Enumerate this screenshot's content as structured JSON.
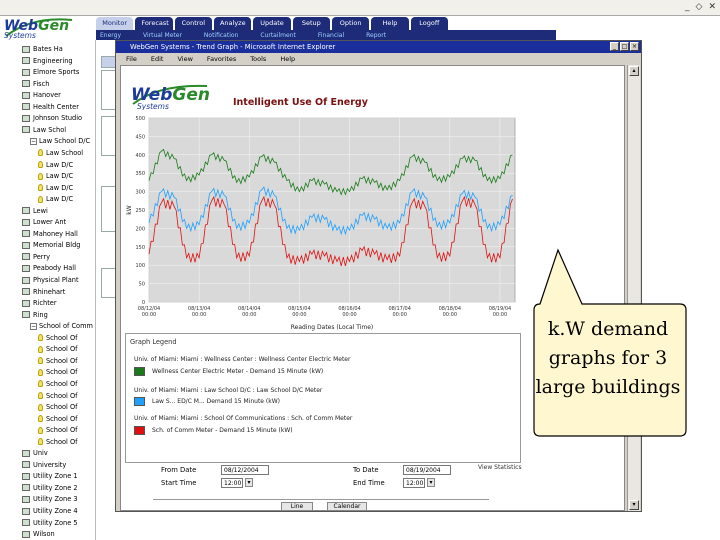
{
  "window": {
    "title": "WebGen Systems - Trend Graph - Microsoft Internet Explorer"
  },
  "brand": {
    "name_web": "Web",
    "name_gen": "Gen",
    "tagline": "Systems",
    "color_blue": "#1d3c9a",
    "color_green": "#2a8a2a"
  },
  "tabs": [
    {
      "label": "Monitor",
      "active": true
    },
    {
      "label": "Forecast"
    },
    {
      "label": "Control"
    },
    {
      "label": "Analyze"
    },
    {
      "label": "Update"
    },
    {
      "label": "Setup"
    },
    {
      "label": "Option"
    },
    {
      "label": "Help"
    },
    {
      "label": "Logoff"
    }
  ],
  "subtabs": [
    "Energy",
    "Virtual Meter",
    "Notification",
    "Curtailment",
    "Financial",
    "Report"
  ],
  "nav": [
    "Bates Ha",
    "Engineering",
    "Elmore Sports",
    "Fisch",
    "Hanover",
    "Health Center",
    "Johnson Studio",
    "Law Schol",
    "Law School D/C",
    "Law School",
    "Law D/C",
    "Law D/C",
    "Law D/C",
    "Law D/C",
    "Lewi",
    "Lower Ant",
    "Mahoney Hall",
    "Memorial Bldg",
    "Perry",
    "Peabody Hall",
    "Physical Plant",
    "Rhinehart",
    "Richter",
    "Ring",
    "School of Comm",
    "School Of",
    "School Of",
    "School Of",
    "School Of",
    "School Of",
    "School Of",
    "School Of",
    "School Of",
    "School Of",
    "School Of",
    "Univ",
    "University",
    "Utility Zone 1",
    "Utility Zone 2",
    "Utility Zone 3",
    "Utility Zone 4",
    "Utility Zone 5",
    "Wilson"
  ],
  "popup": {
    "title": "WebGen Systems - Trend Graph - Microsoft Internet Explorer",
    "menu": [
      "File",
      "Edit",
      "View",
      "Favorites",
      "Tools",
      "Help"
    ],
    "heading": "Intelligent Use Of Energy",
    "legend_title": "Graph Legend",
    "legend": [
      {
        "group": "Univ. of Miami: Miami : Wellness Center : Wellness Center Electric Meter",
        "label": "Wellness Center Electric Meter - Demand 15 Minute (kW)",
        "color": "#1a7a1a"
      },
      {
        "group": "Univ. of Miami: Miami : Law School D/C : Law School D/C Meter",
        "label": "Law S... ED/C M... Demand 15 Minute (kW)",
        "color": "#1ea0ff"
      },
      {
        "group": "Univ. of Miami: Miami : School Of Communications : Sch. of Comm Meter",
        "label": "Sch. of Comm Meter - Demand 15 Minute (kW)",
        "color": "#e01010"
      }
    ],
    "view_statistics": "View Statistics",
    "form": {
      "from_date_label": "From Date",
      "from_date": "08/12/2004",
      "to_date_label": "To Date",
      "to_date": "08/19/2004",
      "start_time_label": "Start Time",
      "start_time": "12:00",
      "end_time_label": "End Time",
      "end_time": "12:00",
      "line_button": "Line",
      "calendar_button": "Calendar"
    }
  },
  "callout": {
    "text": "k.W demand graphs for 3 large buildings"
  },
  "chart_data": {
    "type": "line",
    "title": "Intelligent Use Of Energy",
    "xlabel": "Reading Dates (Local Time)",
    "ylabel": "kW",
    "ylim": [
      0,
      500
    ],
    "yticks": [
      0,
      50,
      100,
      150,
      200,
      250,
      300,
      350,
      400,
      450,
      500
    ],
    "x_tick_labels": [
      "08/12/04 00:00",
      "08/13/04 00:00",
      "08/14/04 00:00",
      "08/15/04 00:00",
      "08/16/04 00:00",
      "08/17/04 00:00",
      "08/18/04 00:00",
      "08/19/04 00:00"
    ],
    "grid": true,
    "x_days": [
      0,
      0.25,
      0.5,
      0.75,
      1,
      1.25,
      1.5,
      1.75,
      2,
      2.25,
      2.5,
      2.75,
      3,
      3.25,
      3.5,
      3.75,
      4,
      4.25,
      4.5,
      4.75,
      5,
      5.25,
      5.5,
      5.75,
      6,
      6.25,
      6.5,
      6.75,
      7,
      7.25
    ],
    "series": [
      {
        "name": "Wellness Center Electric Meter - Demand 15 Minute (kW)",
        "color": "#1a7a1a",
        "values": [
          330,
          410,
          390,
          330,
          345,
          400,
          385,
          325,
          340,
          395,
          380,
          330,
          300,
          330,
          320,
          300,
          300,
          335,
          325,
          305,
          330,
          395,
          380,
          330,
          340,
          390,
          385,
          330,
          335,
          400
        ]
      },
      {
        "name": "Law S... ED/C M... Demand 15 Minute (kW)",
        "color": "#1ea0ff",
        "values": [
          215,
          300,
          285,
          200,
          210,
          300,
          290,
          200,
          215,
          305,
          290,
          200,
          195,
          230,
          225,
          195,
          195,
          235,
          225,
          200,
          215,
          300,
          285,
          205,
          215,
          295,
          285,
          200,
          210,
          290
        ]
      },
      {
        "name": "Sch. of Comm Meter - Demand 15 Minute (kW)",
        "color": "#e01010",
        "values": [
          130,
          270,
          260,
          120,
          120,
          275,
          265,
          120,
          125,
          275,
          265,
          120,
          110,
          130,
          125,
          110,
          110,
          140,
          130,
          115,
          125,
          270,
          260,
          120,
          125,
          275,
          265,
          120,
          120,
          280
        ]
      }
    ]
  }
}
